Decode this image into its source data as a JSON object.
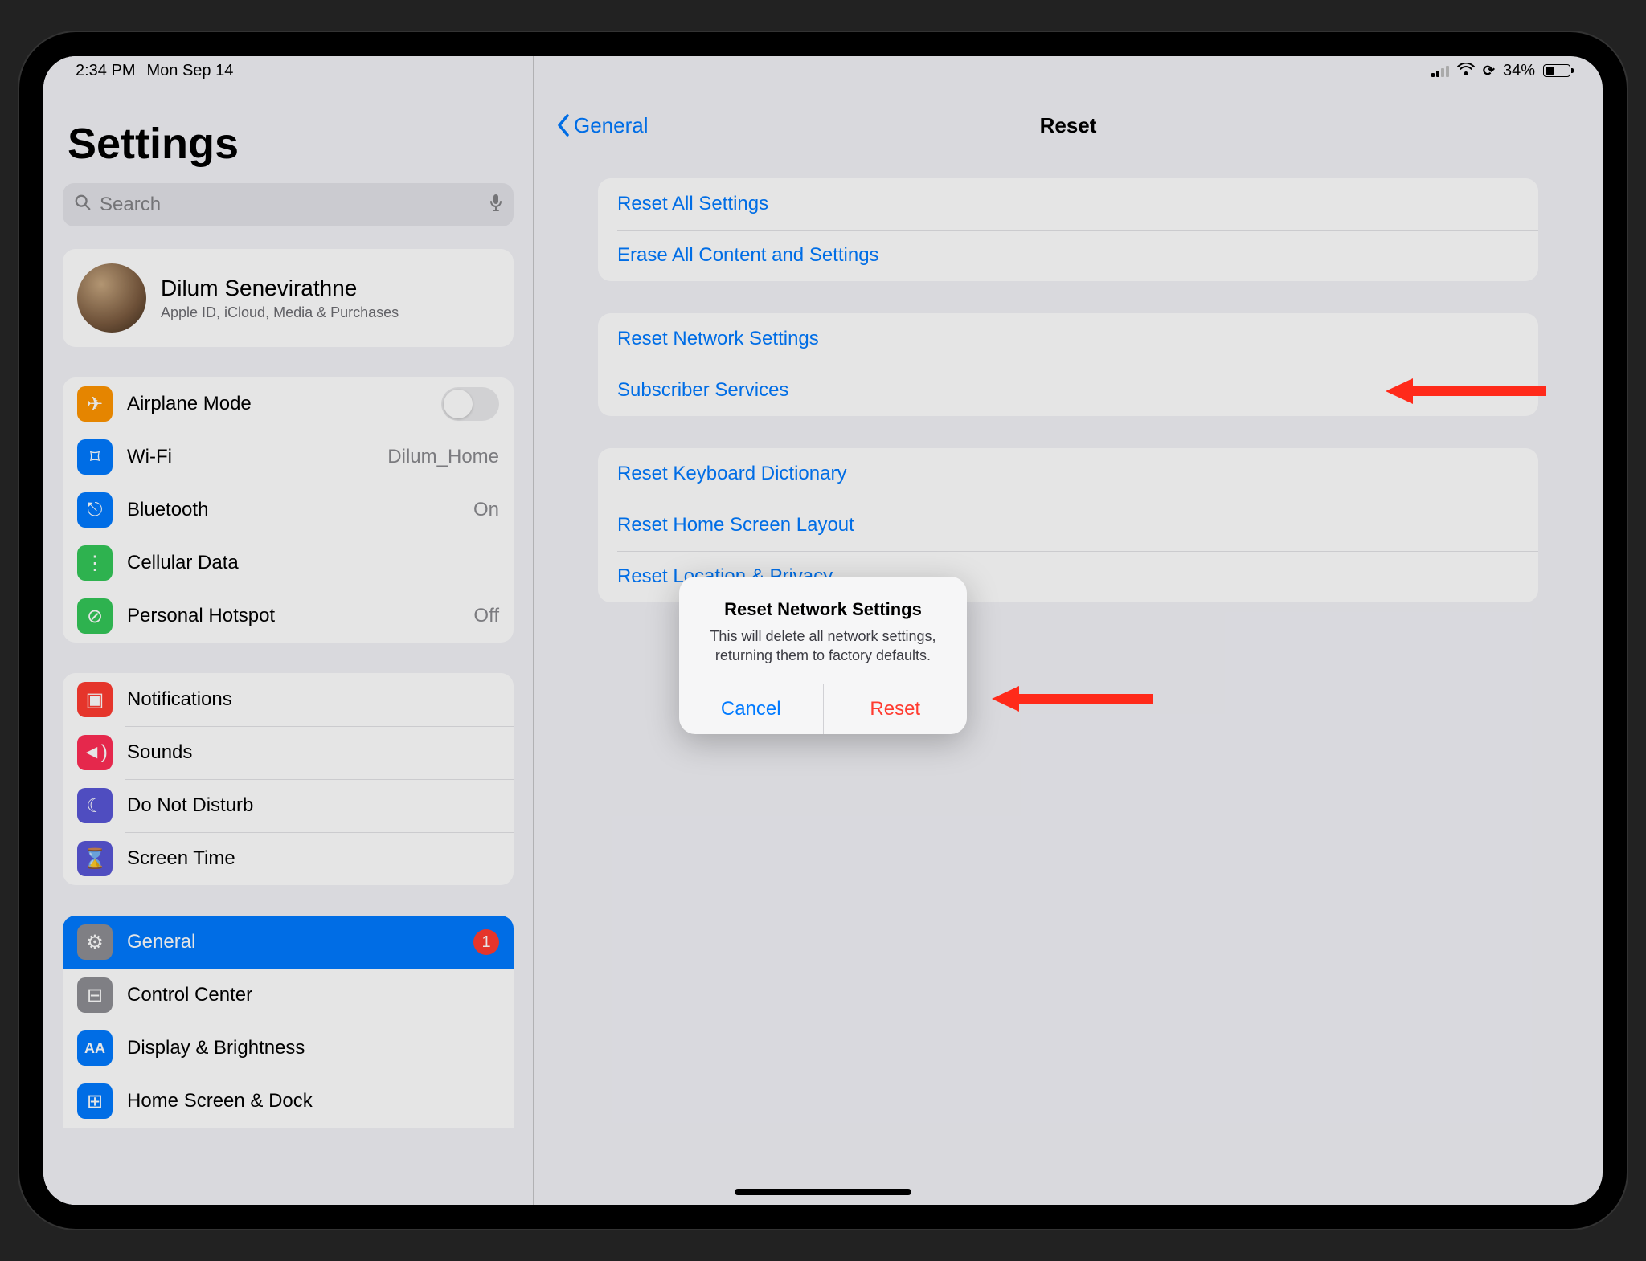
{
  "status": {
    "time": "2:34 PM",
    "date": "Mon Sep 14",
    "battery_pct": "34%"
  },
  "sidebar": {
    "title": "Settings",
    "search_placeholder": "Search",
    "profile": {
      "name": "Dilum Senevirathne",
      "sub": "Apple ID, iCloud, Media & Purchases"
    },
    "rows": [
      {
        "icon": "airplane-icon",
        "label": "Airplane Mode",
        "value": null,
        "color": "orange",
        "glyph": "✈",
        "toggle": true
      },
      {
        "icon": "wifi-icon",
        "label": "Wi-Fi",
        "value": "Dilum_Home",
        "color": "blue",
        "glyph": "⌑"
      },
      {
        "icon": "bluetooth-icon",
        "label": "Bluetooth",
        "value": "On",
        "color": "blue",
        "glyph": "⎋"
      },
      {
        "icon": "cellular-icon",
        "label": "Cellular Data",
        "value": null,
        "color": "green",
        "glyph": "⋮"
      },
      {
        "icon": "hotspot-icon",
        "label": "Personal Hotspot",
        "value": "Off",
        "color": "green",
        "glyph": "⊘"
      }
    ],
    "rows2": [
      {
        "icon": "notifications-icon",
        "label": "Notifications",
        "color": "red",
        "glyph": "▣"
      },
      {
        "icon": "sounds-icon",
        "label": "Sounds",
        "color": "pink",
        "glyph": "◄)"
      },
      {
        "icon": "dnd-icon",
        "label": "Do Not Disturb",
        "color": "purple",
        "glyph": "☾"
      },
      {
        "icon": "screentime-icon",
        "label": "Screen Time",
        "color": "purple",
        "glyph": "⌛"
      }
    ],
    "rows3": [
      {
        "icon": "general-icon",
        "label": "General",
        "color": "gray",
        "glyph": "⚙",
        "active": true,
        "badge": "1"
      },
      {
        "icon": "controlcenter-icon",
        "label": "Control Center",
        "color": "gray",
        "glyph": "⊟"
      },
      {
        "icon": "display-icon",
        "label": "Display & Brightness",
        "color": "blue",
        "glyph": "AA"
      },
      {
        "icon": "homescreen-icon",
        "label": "Home Screen & Dock",
        "color": "blue",
        "glyph": "⊞"
      }
    ]
  },
  "detail": {
    "back_label": "General",
    "title": "Reset",
    "groups": [
      [
        {
          "label": "Reset All Settings"
        },
        {
          "label": "Erase All Content and Settings"
        }
      ],
      [
        {
          "label": "Reset Network Settings"
        },
        {
          "label": "Subscriber Services"
        }
      ],
      [
        {
          "label": "Reset Keyboard Dictionary"
        },
        {
          "label": "Reset Home Screen Layout"
        },
        {
          "label": "Reset Location & Privacy"
        }
      ]
    ]
  },
  "alert": {
    "title": "Reset Network Settings",
    "message": "This will delete all network settings, returning them to factory defaults.",
    "cancel": "Cancel",
    "confirm": "Reset"
  }
}
